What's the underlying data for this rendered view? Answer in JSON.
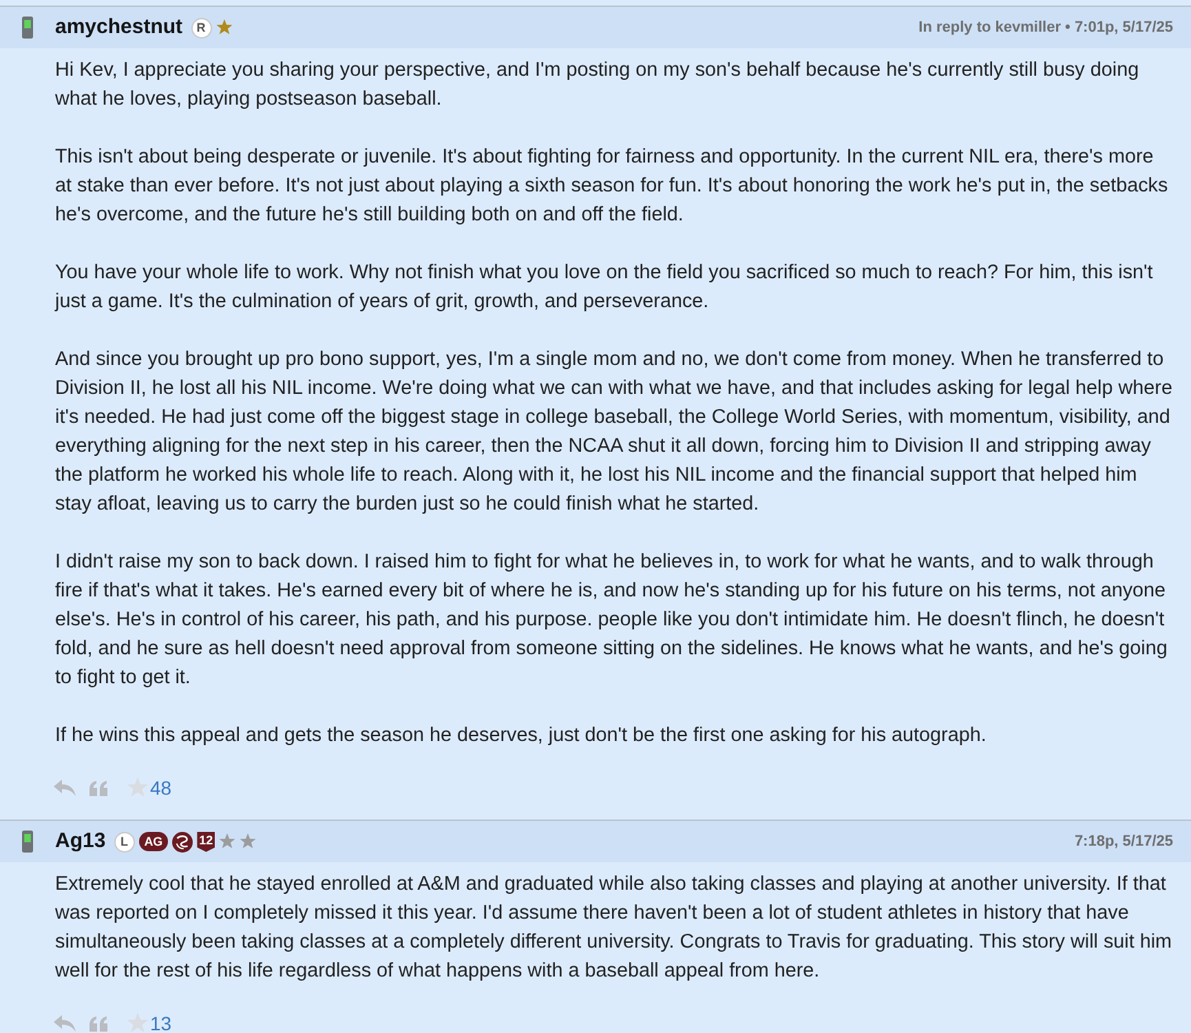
{
  "posts": [
    {
      "author": "amychestnut",
      "badges": [
        {
          "kind": "letter",
          "text": "R"
        },
        {
          "kind": "star",
          "color": "#b08a1c"
        }
      ],
      "meta": "In reply to kevmiller • 7:01p, 5/17/25",
      "paragraphs": [
        "Hi Kev, I appreciate you sharing your perspective, and I'm posting on my son's behalf because he's currently still busy doing what he loves, playing postseason baseball.",
        "This isn't about being desperate or juvenile. It's about fighting for fairness and opportunity. In the current NIL era, there's more at stake than ever before. It's not just about playing a sixth season for fun. It's about honoring the work he's put in, the setbacks he's overcome, and the future he's still building both on and off the field.",
        "You have your whole life to work. Why not finish what you love on the field you sacrificed so much to reach? For him, this isn't just a game. It's the culmination of years of grit, growth, and perseverance.",
        "And since you brought up pro bono support, yes, I'm a single mom and no, we don't come from money. When he transferred to Division II, he lost all his NIL income. We're doing what we can with what we have, and that includes asking for legal help where it's needed. He had just come off the biggest stage in college baseball, the College World Series, with momentum, visibility, and everything aligning for the next step in his career, then the NCAA shut it all down, forcing him to Division II and stripping away the platform he worked his whole life to reach. Along with it, he lost his NIL income and the financial support that helped him stay afloat, leaving us to carry the burden just so he could finish what he started.",
        "I didn't raise my son to back down. I raised him to fight for what he believes in, to work for what he wants, and to walk through fire if that's what it takes. He's earned every bit of where he is, and now he's standing up for his future on his terms, not anyone else's. He's in control of his career, his path, and his purpose. people like you don't intimidate him. He doesn't flinch, he doesn't fold, and he sure as hell doesn't need approval from someone sitting on the sidelines. He knows what he wants, and he's going to fight to get it.",
        "If he wins this appeal and gets the season he deserves, just don't be the first one asking for his autograph."
      ],
      "liked": false,
      "likes": "48"
    },
    {
      "author": "Ag13",
      "badges": [
        {
          "kind": "letter",
          "text": "L"
        },
        {
          "kind": "pill",
          "text": "AG"
        },
        {
          "kind": "emblem"
        },
        {
          "kind": "shield",
          "text": "12"
        },
        {
          "kind": "star",
          "color": "#9c9c9c"
        },
        {
          "kind": "star",
          "color": "#9c9c9c"
        }
      ],
      "meta": "7:18p, 5/17/25",
      "paragraphs": [
        "Extremely cool that he stayed enrolled at A&M and graduated while also taking classes and playing at another university. If that was reported on I completely missed it this year. I'd assume there haven't been a lot of student athletes in history that have simultaneously been taking classes at a completely different university. Congrats to Travis for graduating. This story will suit him well for the rest of his life regardless of what happens with a baseball appeal from here."
      ],
      "liked": false,
      "likes": "13"
    }
  ]
}
